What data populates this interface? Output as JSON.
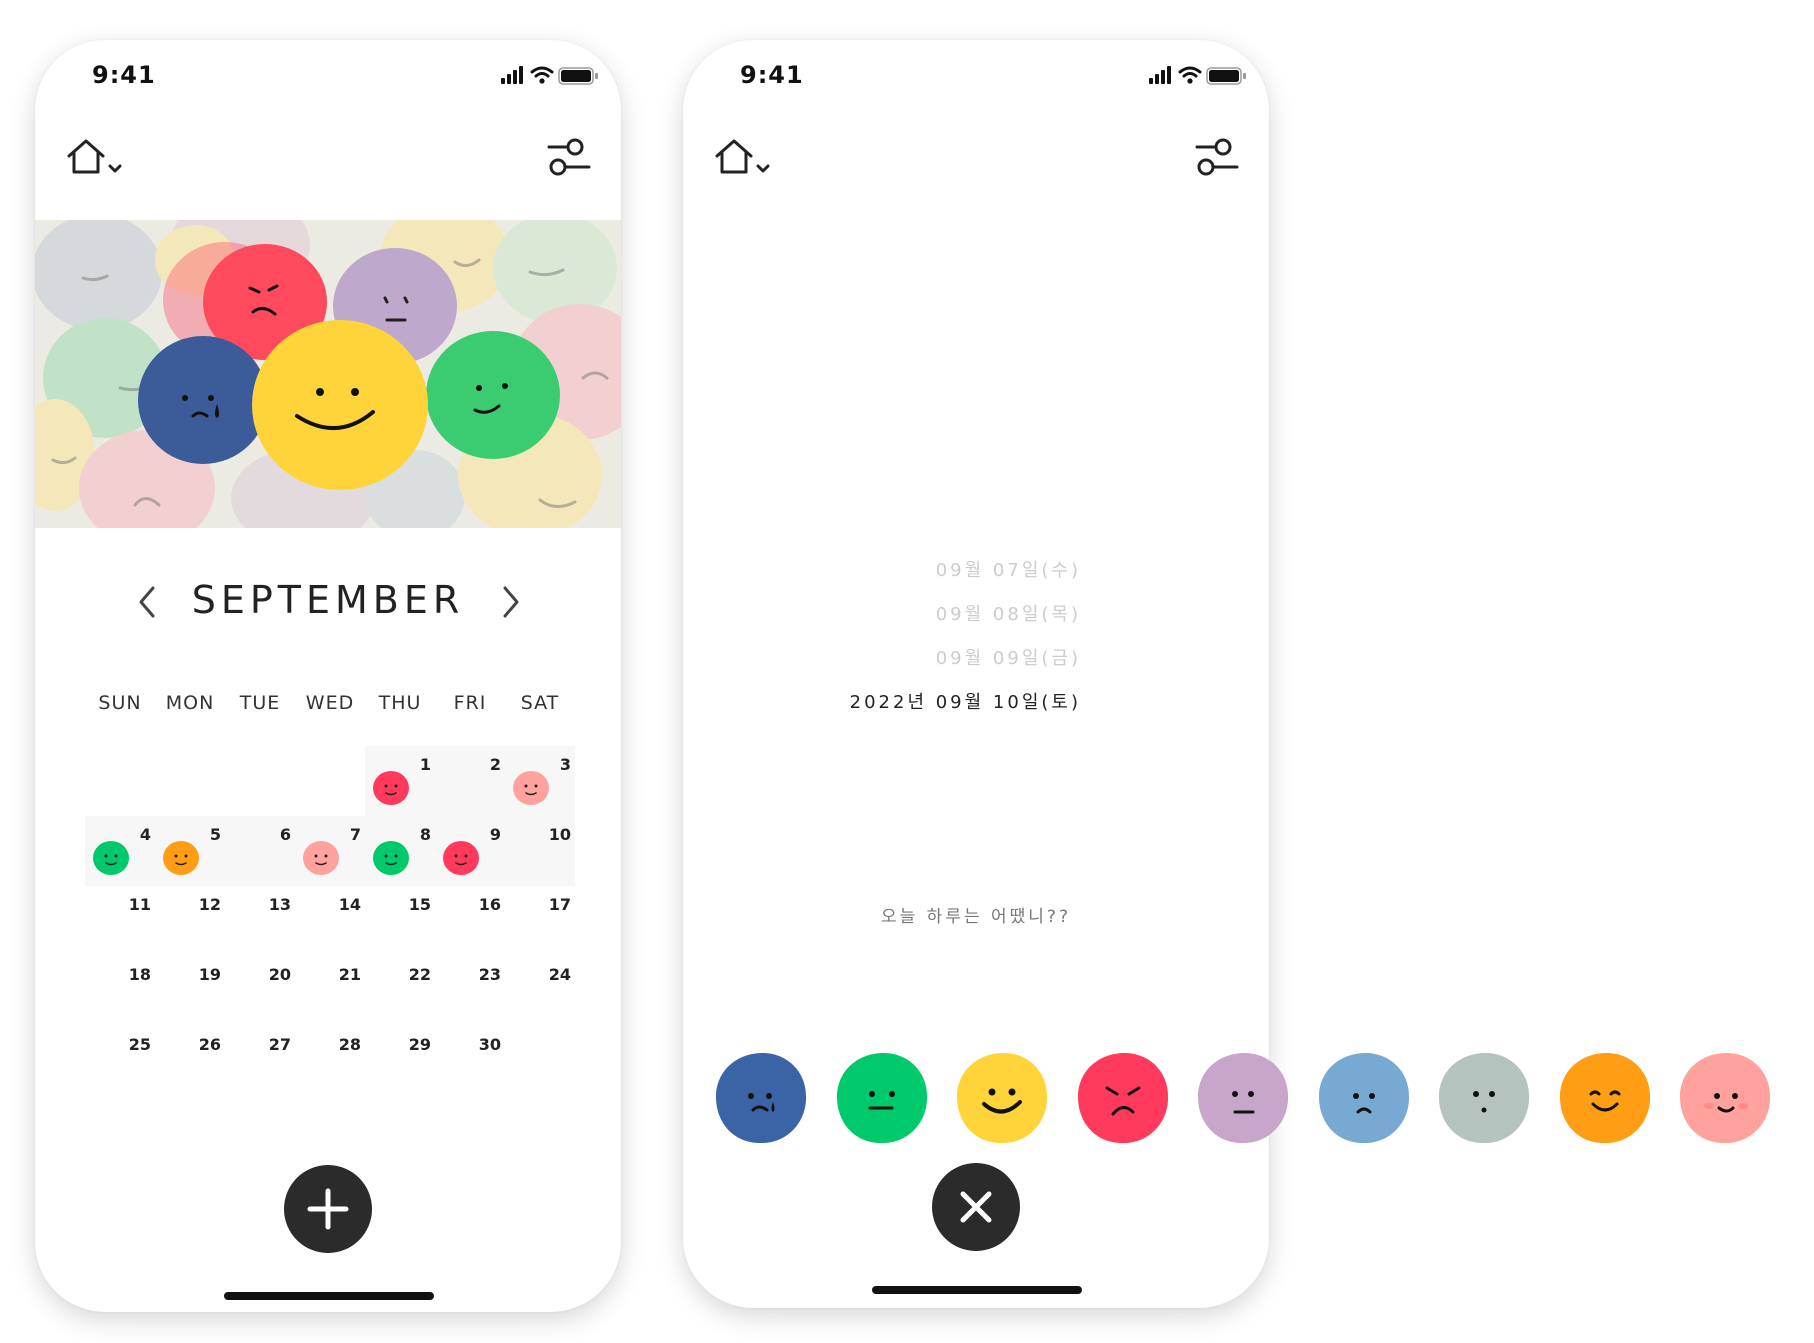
{
  "screens": [
    {
      "status": {
        "time": "9:41"
      },
      "month": "SEPTEMBER",
      "weekdays": [
        "SUN",
        "MON",
        "TUE",
        "WED",
        "THU",
        "FRI",
        "SAT"
      ],
      "days": [
        {
          "d": "1",
          "mood": "#ff3a5c"
        },
        {
          "d": "2"
        },
        {
          "d": "3",
          "mood": "#ffa19c"
        },
        {
          "d": "4",
          "mood": "#00c96b"
        },
        {
          "d": "5",
          "mood": "#ff9d14"
        },
        {
          "d": "6"
        },
        {
          "d": "7",
          "mood": "#ffa19c"
        },
        {
          "d": "8",
          "mood": "#00c96b"
        },
        {
          "d": "9",
          "mood": "#ff3a5c"
        },
        {
          "d": "10"
        },
        {
          "d": "11"
        },
        {
          "d": "12"
        },
        {
          "d": "13"
        },
        {
          "d": "14"
        },
        {
          "d": "15"
        },
        {
          "d": "16"
        },
        {
          "d": "17"
        },
        {
          "d": "18"
        },
        {
          "d": "19"
        },
        {
          "d": "20"
        },
        {
          "d": "21"
        },
        {
          "d": "22"
        },
        {
          "d": "23"
        },
        {
          "d": "24"
        },
        {
          "d": "25"
        },
        {
          "d": "26"
        },
        {
          "d": "27"
        },
        {
          "d": "28"
        },
        {
          "d": "29"
        },
        {
          "d": "30"
        }
      ]
    },
    {
      "status": {
        "time": "9:41"
      },
      "date_options": [
        "09월 07일(수)",
        "09월 08일(목)",
        "09월 09일(금)",
        "2022년 09월 10일(토)"
      ],
      "prompt": "오늘 하루는 어땠니??",
      "moods": [
        {
          "icon": "sad-blue-face-icon",
          "color": "#3a64a5"
        },
        {
          "icon": "calm-green-face-icon",
          "color": "#00c96b"
        },
        {
          "icon": "happy-yellow-face-icon",
          "color": "#ffd43b"
        },
        {
          "icon": "angry-red-face-icon",
          "color": "#ff3a5c"
        },
        {
          "icon": "unsure-purple-face-icon",
          "color": "#c8a6cb"
        },
        {
          "icon": "down-lightblue-face-icon",
          "color": "#77a9d2"
        },
        {
          "icon": "blank-grey-face-icon",
          "color": "#b5c3be"
        },
        {
          "icon": "cheerful-orange-face-icon",
          "color": "#ff9d14"
        },
        {
          "icon": "shy-pink-face-icon",
          "color": "#ffa19c"
        }
      ]
    }
  ]
}
